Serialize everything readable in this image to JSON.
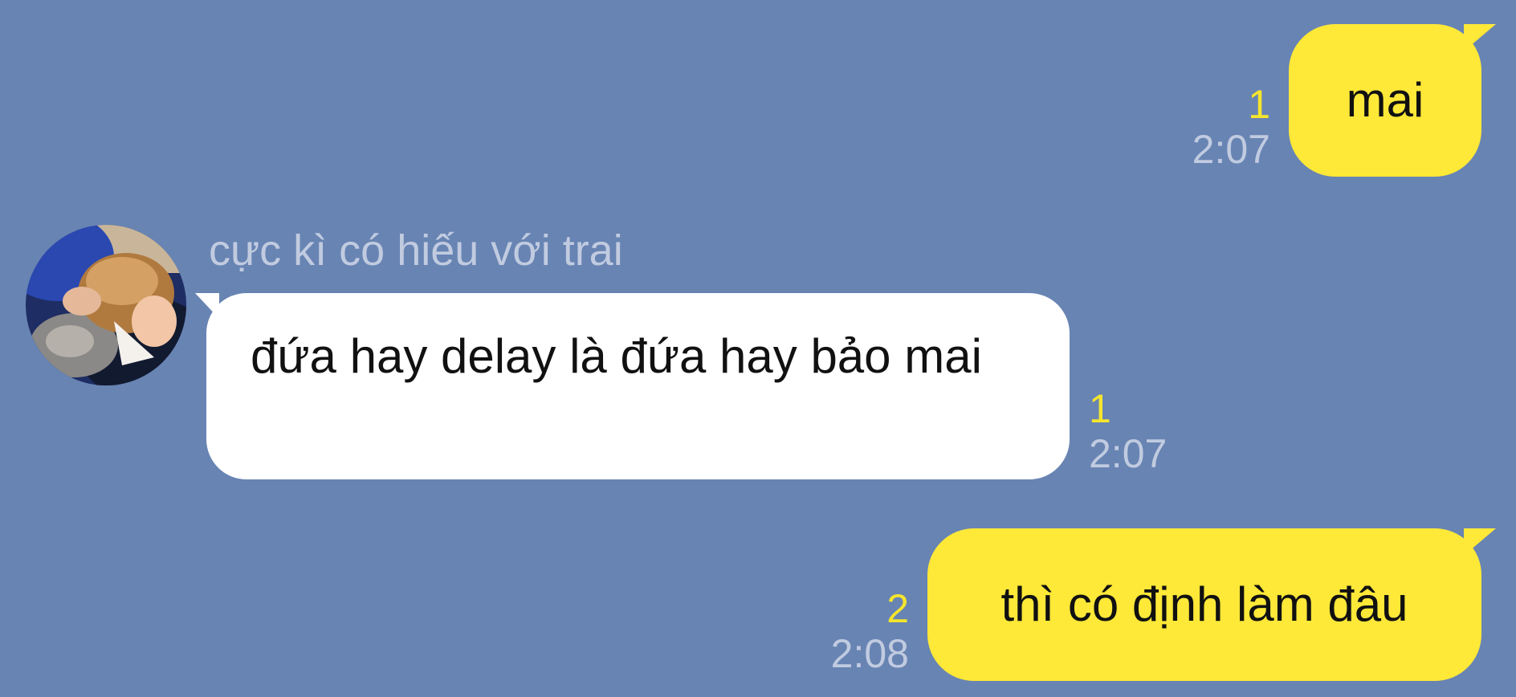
{
  "colors": {
    "background": "#6884b3",
    "my_bubble": "#fee838",
    "their_bubble": "#ffffff",
    "unread": "#f5e52d",
    "time": "#c1cbe0",
    "sender_name": "#c1cbe0"
  },
  "icons": {
    "avatar": "profile-photo"
  },
  "messages": [
    {
      "direction": "outgoing",
      "text": "mai",
      "unread": "1",
      "time": "2:07"
    },
    {
      "direction": "incoming",
      "sender": "cực kì có hiếu với trai",
      "text": "đứa hay delay là đứa hay bảo mai",
      "unread": "1",
      "time": "2:07"
    },
    {
      "direction": "outgoing",
      "text": "thì có định làm đâu",
      "unread": "2",
      "time": "2:08"
    }
  ]
}
